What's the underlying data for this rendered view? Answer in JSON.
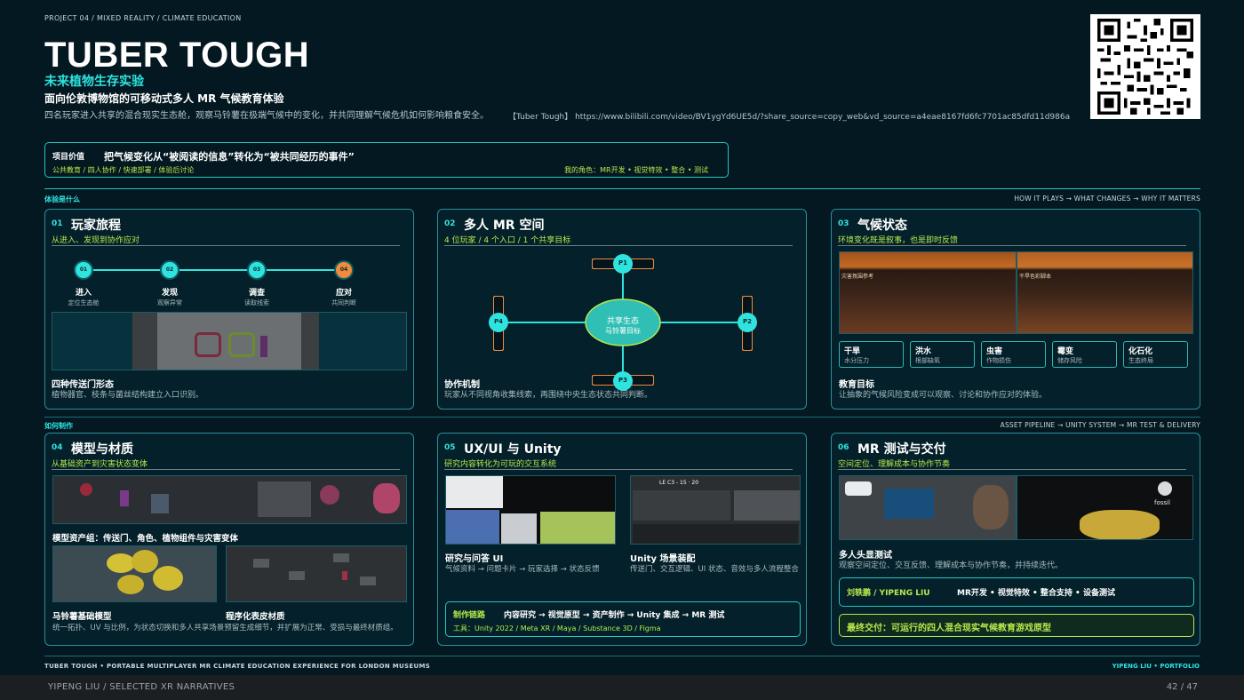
{
  "header": {
    "breadcrumb": "PROJECT 04 / MIXED REALITY / CLIMATE EDUCATION",
    "title": "TUBER TOUGH",
    "subtitle": "未来植物生存实验",
    "tagline": "面向伦敦博物馆的可移动式多人 MR 气候教育体验",
    "description": "四名玩家进入共享的混合现实生态舱，观察马铃薯在极端气候中的变化，并共同理解气候危机如何影响粮食安全。",
    "link": "【Tuber Tough】 https://www.bilibili.com/video/BV1ygYd6UE5d/?share_source=copy_web&vd_source=a4eae8167fd6fc7701ac85dfd11d986a"
  },
  "value_box": {
    "label": "项目价值",
    "statement": "把气候变化从“被阅读的信息”转化为“被共同经历的事件”",
    "tags": "公共教育 / 四人协作 / 快速部署 / 体验后讨论",
    "role": "我的角色：MR开发 • 视觉特效 • 整合 • 测试"
  },
  "section1": {
    "label": "体验是什么",
    "flow": "HOW IT PLAYS → WHAT CHANGES → WHY IT MATTERS"
  },
  "section2": {
    "label": "如何制作",
    "flow": "ASSET PIPELINE → UNITY SYSTEM → MR TEST & DELIVERY"
  },
  "card1": {
    "num": "01",
    "title": "玩家旅程",
    "sub": "从进入、发现到协作应对",
    "steps": [
      {
        "dot": "01",
        "label": "进入",
        "sub": "定位生态舱"
      },
      {
        "dot": "02",
        "label": "发现",
        "sub": "观察异常"
      },
      {
        "dot": "03",
        "label": "调查",
        "sub": "读取线索"
      },
      {
        "dot": "04",
        "label": "应对",
        "sub": "共同判断"
      }
    ],
    "cap_title": "四种传送门形态",
    "cap_text": "植物器官、枝条与菌丝结构建立入口识别。"
  },
  "card2": {
    "num": "02",
    "title": "多人 MR 空间",
    "sub": "4 位玩家 / 4 个入口 / 1 个共享目标",
    "players": [
      "P1",
      "P2",
      "P3",
      "P4"
    ],
    "center_line1": "共享生态",
    "center_line2": "马铃薯目标",
    "cap_title": "协作机制",
    "cap_text": "玩家从不同视角收集线索，再围绕中央生态状态共同判断。"
  },
  "card3": {
    "num": "03",
    "title": "气候状态",
    "sub": "环境变化既是叙事，也是即时反馈",
    "shot_labels": [
      "灾害氛围参考",
      "干旱色彩脚本"
    ],
    "chips": [
      {
        "name": "干旱",
        "sub": "水分压力"
      },
      {
        "name": "洪水",
        "sub": "根部缺氧"
      },
      {
        "name": "虫害",
        "sub": "作物损伤"
      },
      {
        "name": "霉变",
        "sub": "储存风险"
      },
      {
        "name": "化石化",
        "sub": "生态终局"
      }
    ],
    "cap_title": "教育目标",
    "cap_text": "让抽象的气候风险变成可以观察、讨论和协作应对的体验。"
  },
  "card4": {
    "num": "04",
    "title": "模型与材质",
    "sub": "从基础资产到灾害状态变体",
    "cap1_title": "模型资产组：传送门、角色、植物组件与灾害变体",
    "cap2_title": "马铃薯基础模型",
    "cap3_title": "程序化表皮材质",
    "cap_text": "统一拓扑、UV 与比例，为状态切换和多人共享场景预留生成细节，并扩展为正常、受损与最终材质组。"
  },
  "card5": {
    "num": "05",
    "title": "UX/UI 与 Unity",
    "sub": "研究内容转化为可玩的交互系统",
    "cap1_title": "研究与问答 UI",
    "cap1_text": "气候资料 → 问题卡片 → 玩家选择 → 状态反馈",
    "cap2_title": "Unity 场景装配",
    "cap2_text": "传送门、交互逻辑、UI 状态、音效与多人流程整合",
    "pipeline_label": "制作链路",
    "pipeline": "内容研究 → 视觉原型 → 资产制作 → Unity 集成 → MR 测试",
    "tools": "工具：Unity 2022 / Meta XR / Maya / Substance 3D / Figma",
    "shot_title": "LE C3 - 15 · 20"
  },
  "card6": {
    "num": "06",
    "title": "MR 测试与交付",
    "sub": "空间定位、理解成本与协作节奏",
    "fossil_label": "fossil",
    "cap_title": "多人头显测试",
    "cap_text": "观察空间定位、交互反馈、理解成本与协作节奏，并持续迭代。",
    "person": "刘轶鹏 / YIPENG LIU",
    "person_roles": "MR开发 • 视觉特效 • 整合支持 • 设备测试",
    "delivery": "最终交付：可运行的四人混合现实气候教育游戏原型"
  },
  "footer": {
    "left": "TUBER TOUGH  •  PORTABLE MULTIPLAYER MR CLIMATE EDUCATION EXPERIENCE FOR LONDON MUSEUMS",
    "right": "YIPENG LIU  •  PORTFOLIO"
  },
  "bottom_bar": {
    "left": "YIPENG LIU  /  SELECTED XR NARRATIVES",
    "page": "42 / 47"
  },
  "colors": {
    "accent": "#2fe3de",
    "lime": "#b7e94a",
    "orange": "#f08a3e",
    "background": "#031821"
  }
}
